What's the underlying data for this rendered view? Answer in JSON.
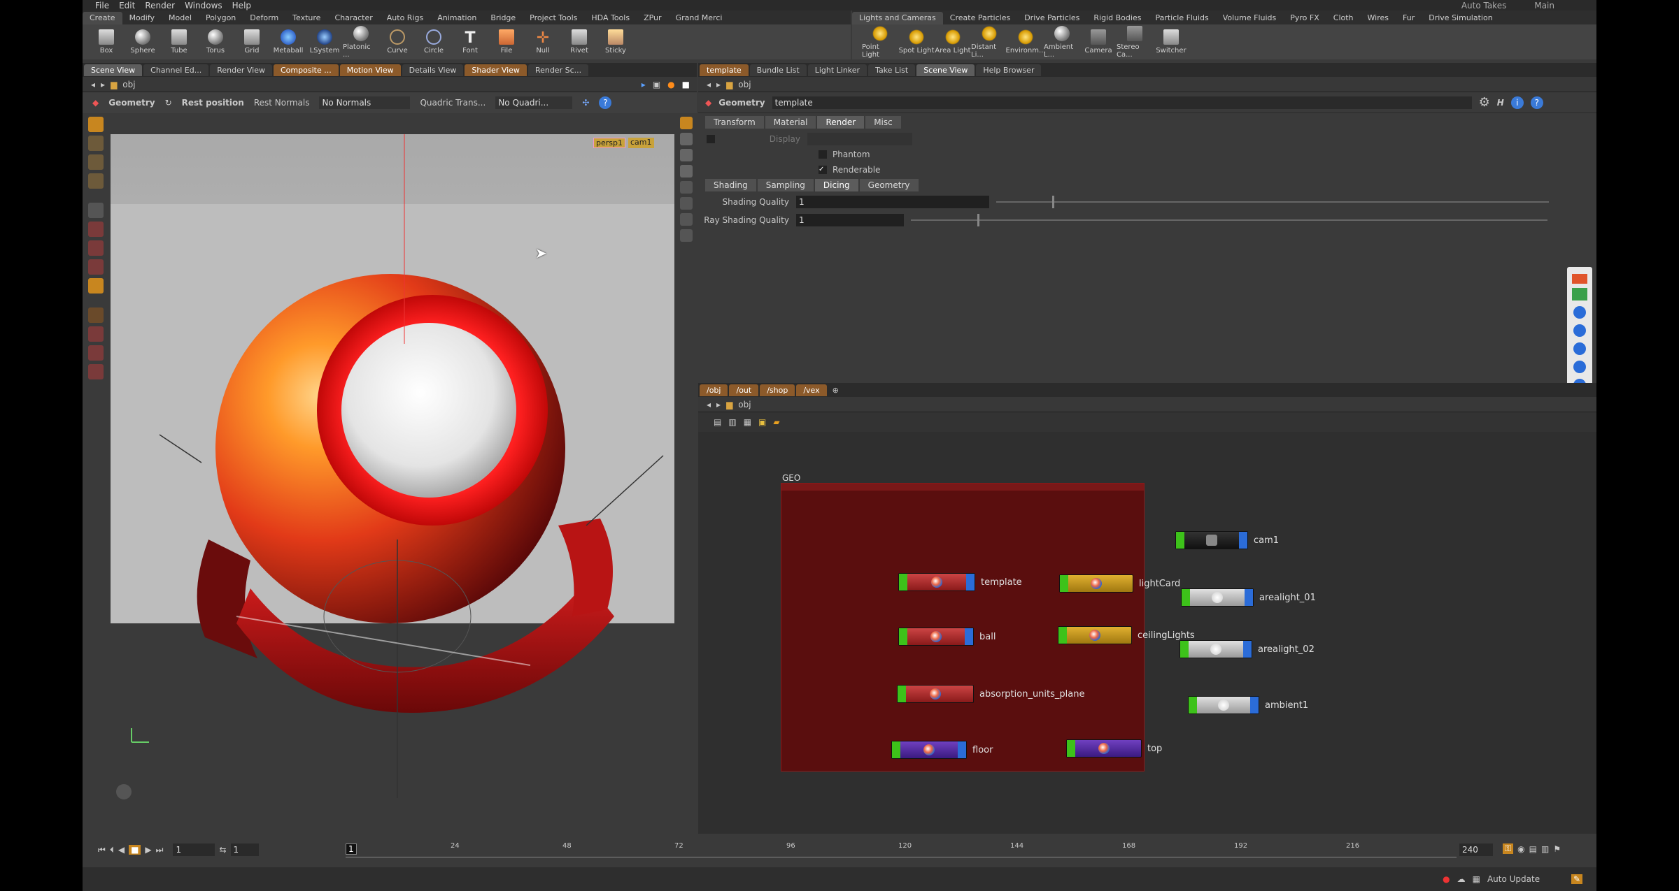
{
  "menu": [
    "File",
    "Edit",
    "Render",
    "Windows",
    "Help"
  ],
  "menu_right": {
    "takes": "Auto Takes",
    "desktop": "Main"
  },
  "shelf_tabs_left": [
    "Create",
    "Modify",
    "Model",
    "Polygon",
    "Deform",
    "Texture",
    "Character",
    "Auto Rigs",
    "Animation",
    "Bridge",
    "Project Tools",
    "HDA Tools",
    "ZPur",
    "Grand Merci"
  ],
  "shelf_tabs_right": [
    "Lights and Cameras",
    "Create Particles",
    "Drive Particles",
    "Rigid Bodies",
    "Particle Fluids",
    "Volume Fluids",
    "Pyro FX",
    "Cloth",
    "Wires",
    "Fur",
    "Drive Simulation"
  ],
  "tools_left": [
    "Box",
    "Sphere",
    "Tube",
    "Torus",
    "Grid",
    "Metaball",
    "LSystem",
    "Platonic ...",
    "Curve",
    "Circle",
    "Font",
    "File",
    "Null",
    "Rivet",
    "Sticky"
  ],
  "tools_right": [
    "Point Light",
    "Spot Light",
    "Area Light",
    "Distant Li...",
    "Environm...",
    "Ambient L...",
    "Camera",
    "Stereo Ca...",
    "Switcher"
  ],
  "left_tabs": [
    "Scene View",
    "Channel Ed...",
    "Render View",
    "Composite ...",
    "Motion View",
    "Details View",
    "Shader View",
    "Render Sc..."
  ],
  "left_path": "obj",
  "viewport_toolbar": {
    "geometry": "Geometry",
    "rest_position": "Rest position",
    "rest_normals": "Rest Normals",
    "no_normals": "No Normals",
    "quadric_trans": "Quadric Trans...",
    "no_quadric": "No Quadri..."
  },
  "viewport_tags": {
    "persp": "persp1",
    "cam": "cam1"
  },
  "right_tabs": [
    "template",
    "Bundle List",
    "Light Linker",
    "Take List",
    "Scene View",
    "Help Browser"
  ],
  "right_path": "obj",
  "param": {
    "type": "Geometry",
    "name": "template",
    "tabs": [
      "Transform",
      "Material",
      "Render",
      "Misc"
    ],
    "display_label": "Display",
    "phantom": "Phantom",
    "renderable": "Renderable",
    "subtabs": [
      "Shading",
      "Sampling",
      "Dicing",
      "Geometry"
    ],
    "shading_quality_label": "Shading Quality",
    "shading_quality": "1",
    "ray_shading_label": "Ray Shading Quality",
    "ray_shading": "1"
  },
  "net_tabs": [
    "/obj",
    "/out",
    "/shop",
    "/vex"
  ],
  "net_path": "obj",
  "netbox_title": "GEO",
  "nodes": {
    "template": "template",
    "lightCard": "lightCard",
    "ball": "ball",
    "ceilingLights": "ceilingLights",
    "absorption": "absorption_units_plane",
    "floor": "floor",
    "top": "top",
    "cam1": "cam1",
    "arealight_01": "arealight_01",
    "arealight_02": "arealight_02",
    "ambient1": "ambient1"
  },
  "timeline": {
    "frame": "1",
    "start": "1",
    "step": "1",
    "end": "240",
    "ticks": [
      "24",
      "48",
      "72",
      "96",
      "120",
      "144",
      "168",
      "192",
      "216"
    ]
  },
  "status": {
    "auto_update": "Auto Update"
  }
}
